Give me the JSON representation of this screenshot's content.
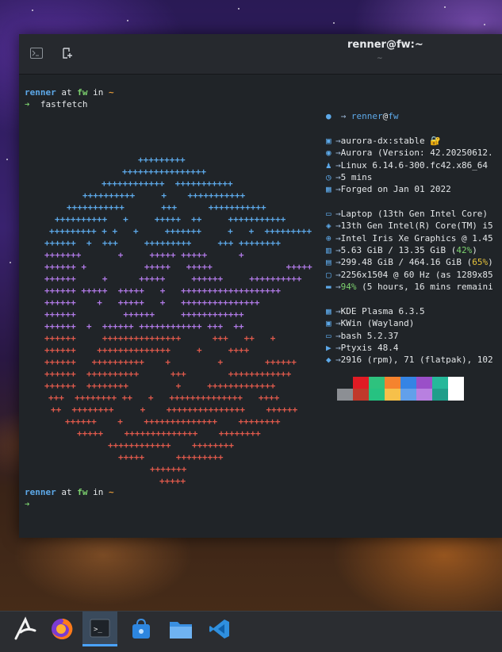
{
  "window": {
    "title": "renner@fw:~",
    "subtitle": "~"
  },
  "prompt1": {
    "user": "renner",
    "at": "at",
    "host": "fw",
    "in": "in",
    "dir": "~",
    "arrow": "➔",
    "command": "fastfetch"
  },
  "logo": [
    {
      "text": "+++++++++",
      "color": "#5da9e9"
    },
    {
      "text": "++++++++++++++++",
      "color": "#5da9e9"
    },
    {
      "text": "++++++++++++  +++++++++++",
      "color": "#5da9e9"
    },
    {
      "text": "++++++++++     +    +++++++++++",
      "color": "#5da9e9"
    },
    {
      "text": "+++++++++++       +++      +++++++++++",
      "color": "#5da9e9"
    },
    {
      "text": "++++++++++   +     +++++  ++     +++++++++++",
      "color": "#5da9e9"
    },
    {
      "text": "+++++++++ + +   +     +++++++     +   +  +++++++++",
      "color": "#5da9e9"
    },
    {
      "text": "++++++  +  +++     +++++++++     +++ ++++++++",
      "color": "#5da9e9"
    },
    {
      "text": "+++++++       +     +++++ +++++      +",
      "color": "#b07ae6"
    },
    {
      "text": "++++++ +           +++++   +++++              +++++",
      "color": "#b07ae6"
    },
    {
      "text": "++++++     +      +++++     ++++++     ++++++++++",
      "color": "#b07ae6"
    },
    {
      "text": "++++++ +++++  +++++   +   +++++++++++++++++++",
      "color": "#b07ae6"
    },
    {
      "text": "++++++    +   +++++   +   +++++++++++++++",
      "color": "#b07ae6"
    },
    {
      "text": "++++++         ++++++     ++++++++++++",
      "color": "#b07ae6"
    },
    {
      "text": "++++++  +  ++++++ ++++++++++++ +++  ++",
      "color": "#b07ae6"
    },
    {
      "text": "++++++     +++++++++++++++      +++   ++   +",
      "color": "#e05a4c"
    },
    {
      "text": "++++++    ++++++++++++++     +     ++++",
      "color": "#e05a4c"
    },
    {
      "text": "++++++   ++++++++++    +         +        ++++++",
      "color": "#e05a4c"
    },
    {
      "text": "++++++  ++++++++++      +++        ++++++++++++",
      "color": "#e05a4c"
    },
    {
      "text": "++++++  ++++++++         +     +++++++++++++",
      "color": "#e05a4c"
    },
    {
      "text": "+++  ++++++++ ++   +   ++++++++++++++   ++++",
      "color": "#e05a4c"
    },
    {
      "text": "++  ++++++++     +    +++++++++++++++    ++++++",
      "color": "#e05a4c"
    },
    {
      "text": "++++++    +    ++++++++++++++    ++++++++",
      "color": "#e05a4c"
    },
    {
      "text": "+++++    ++++++++++++++    ++++++++",
      "color": "#e05a4c"
    },
    {
      "text": "++++++++++++    ++++++++",
      "color": "#e05a4c"
    },
    {
      "text": "+++++      +++++++++",
      "color": "#e05a4c"
    },
    {
      "text": "+++++++",
      "color": "#e05a4c"
    },
    {
      "text": "+++++",
      "color": "#e05a4c"
    }
  ],
  "info": {
    "header": {
      "icon": "user-icon",
      "user": "renner",
      "at": "@",
      "host": "fw"
    },
    "rows_group1": [
      {
        "icon": "image-icon",
        "text": "aurora-dx:stable 🔐"
      },
      {
        "icon": "distro-icon",
        "text": "Aurora (Version: 42.20250612."
      },
      {
        "icon": "linux-icon",
        "text": "Linux 6.14.6-300.fc42.x86_64"
      },
      {
        "icon": "clock-icon",
        "text": "5 mins"
      },
      {
        "icon": "calendar-icon",
        "text": "Forged on Jan 01 2022"
      }
    ],
    "rows_group2": [
      {
        "icon": "laptop-icon",
        "text": "Laptop (13th Gen Intel Core)"
      },
      {
        "icon": "cpu-icon",
        "text": "13th Gen Intel(R) Core(TM) i5"
      },
      {
        "icon": "gpu-icon",
        "text": "Intel Iris Xe Graphics @ 1.45"
      },
      {
        "icon": "memory-icon",
        "text": "5.63 GiB / 13.35 GiB (",
        "pct": "42%",
        "pct_color": "#7dd36f",
        "tail": ")"
      },
      {
        "icon": "disk-icon",
        "text": "299.48 GiB / 464.16 GiB (",
        "pct": "65%",
        "pct_color": "#e5c23a",
        "tail": ")"
      },
      {
        "icon": "display-icon",
        "text": "2256x1504 @ 60 Hz (as 1289x85"
      },
      {
        "icon": "battery-icon",
        "text": "",
        "pct": "94%",
        "pct_color": "#7dd36f",
        "tail": " (5 hours, 16 mins remaini"
      }
    ],
    "rows_group3": [
      {
        "icon": "kde-icon",
        "text": "KDE Plasma 6.3.5"
      },
      {
        "icon": "window-manager-icon",
        "text": "KWin (Wayland)"
      },
      {
        "icon": "shell-icon",
        "text": "bash 5.2.37"
      },
      {
        "icon": "terminal-icon",
        "text": "Ptyxis 48.4"
      },
      {
        "icon": "package-icon",
        "text": "2916 (rpm), 71 (flatpak), 102"
      }
    ],
    "arrow": "→"
  },
  "palette": {
    "top": [
      "#202428",
      "#e01b24",
      "#2ec27e",
      "#f5832e",
      "#3584e4",
      "#9a4fc8",
      "#26b89a",
      "#ffffff"
    ],
    "bottom": [
      "#8c8f94",
      "#c0392b",
      "#26c281",
      "#f6c04a",
      "#62a0ea",
      "#b880e0",
      "#1f9e8a",
      "#ffffff"
    ]
  },
  "prompt2": {
    "user": "renner",
    "at": "at",
    "host": "fw",
    "in": "in",
    "dir": "~",
    "arrow": "➔"
  },
  "taskbar": [
    "app-launcher",
    "firefox",
    "terminal",
    "discover-store",
    "file-manager",
    "vscode"
  ]
}
